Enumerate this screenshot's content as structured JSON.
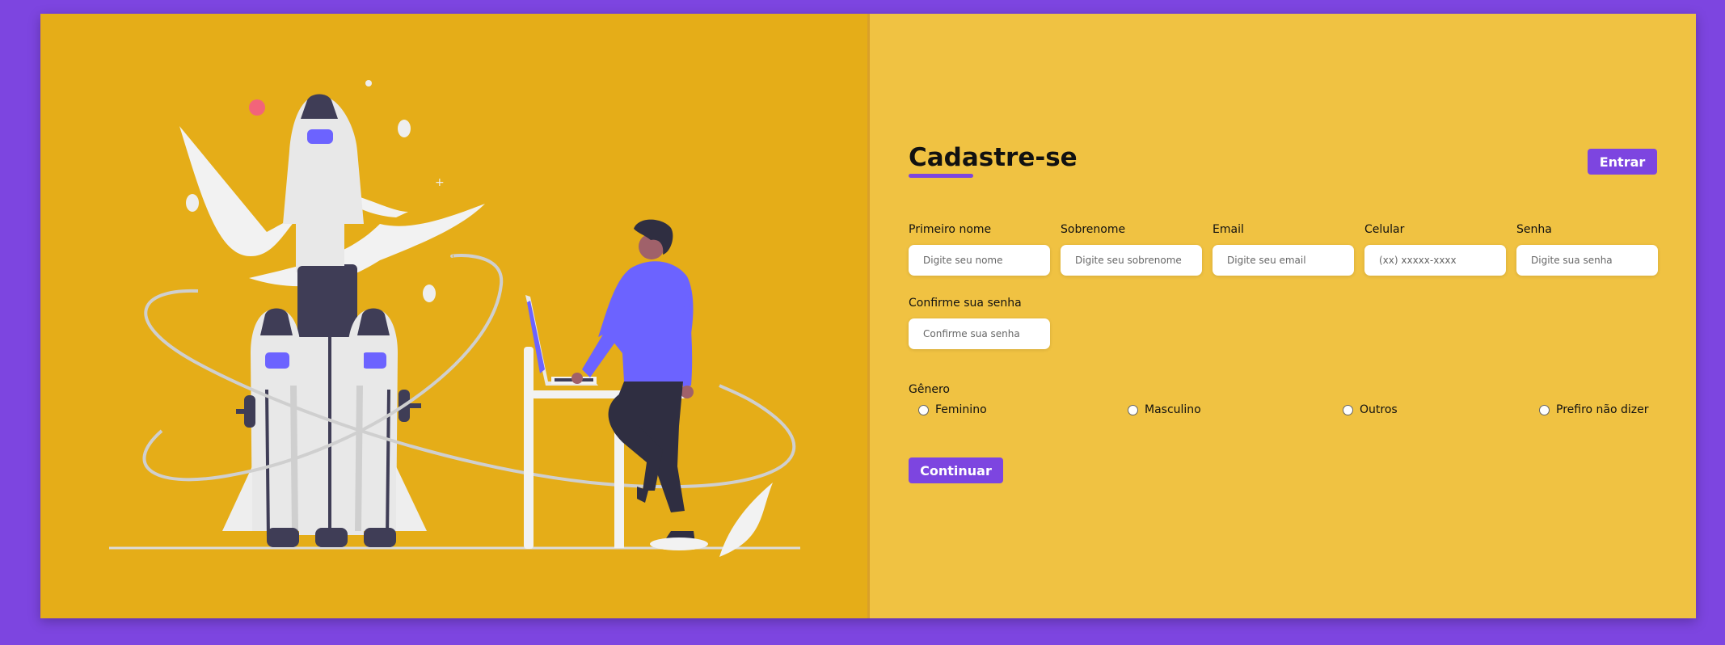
{
  "colors": {
    "background": "#7d45e0",
    "illustration_bg": "#e5ad18",
    "form_bg": "#f0c242",
    "accent": "#7d45e0"
  },
  "form": {
    "title": "Cadastre-se",
    "login_button": "Entrar",
    "fields": {
      "first_name": {
        "label": "Primeiro nome",
        "placeholder": "Digite seu nome"
      },
      "last_name": {
        "label": "Sobrenome",
        "placeholder": "Digite seu sobrenome"
      },
      "email": {
        "label": "Email",
        "placeholder": "Digite seu email"
      },
      "phone": {
        "label": "Celular",
        "placeholder": "(xx) xxxxx-xxxx"
      },
      "password": {
        "label": "Senha",
        "placeholder": "Digite sua senha"
      },
      "confirm_password": {
        "label": "Confirme sua senha",
        "placeholder": "Confirme sua senha"
      }
    },
    "gender": {
      "label": "Gênero",
      "options": [
        "Feminino",
        "Masculino",
        "Outros",
        "Prefiro não dizer"
      ]
    },
    "submit_button": "Continuar"
  },
  "illustration": {
    "subject": "rocket launch with person at laptop"
  }
}
